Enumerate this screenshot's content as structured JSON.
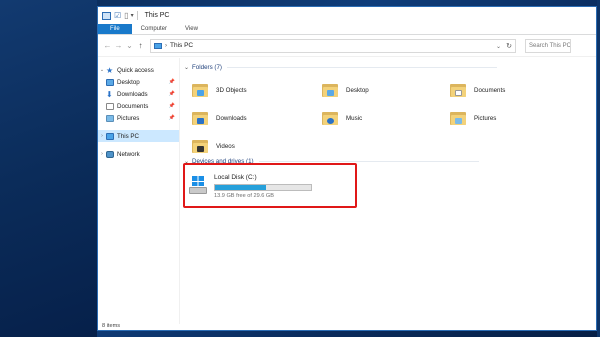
{
  "window": {
    "title": "This PC"
  },
  "ribbon": {
    "tabs": [
      "File",
      "Computer",
      "View"
    ]
  },
  "address": {
    "nav_back": "←",
    "nav_forward": "→",
    "nav_dropdown": "⌄",
    "nav_up": "↑",
    "path": "This PC",
    "search_placeholder": "Search This PC"
  },
  "sidebar": {
    "items": [
      {
        "label": "Quick access"
      },
      {
        "label": "Desktop"
      },
      {
        "label": "Downloads"
      },
      {
        "label": "Documents"
      },
      {
        "label": "Pictures"
      },
      {
        "label": "This PC"
      },
      {
        "label": "Network"
      }
    ]
  },
  "folders_header": "Folders (7)",
  "folders": [
    {
      "label": "3D Objects",
      "badge_color": "#4aa3e8"
    },
    {
      "label": "Desktop",
      "badge_color": "#5ba9e6"
    },
    {
      "label": "Documents",
      "badge_color": "#ffffff"
    },
    {
      "label": "Downloads",
      "badge_color": "#2a72c8"
    },
    {
      "label": "Music",
      "badge_color": "#2a72c8"
    },
    {
      "label": "Pictures",
      "badge_color": "#7bbbe8"
    },
    {
      "label": "Videos",
      "badge_color": "#333333"
    }
  ],
  "devices_header": "Devices and drives (1)",
  "drive": {
    "name": "Local Disk (C:)",
    "free_text": "13.9 GB free of 29.6 GB",
    "used_fraction": 0.53,
    "bar_color": "#26a0da"
  },
  "status": {
    "items_text": "8 items"
  },
  "highlight_color": "#e01818"
}
